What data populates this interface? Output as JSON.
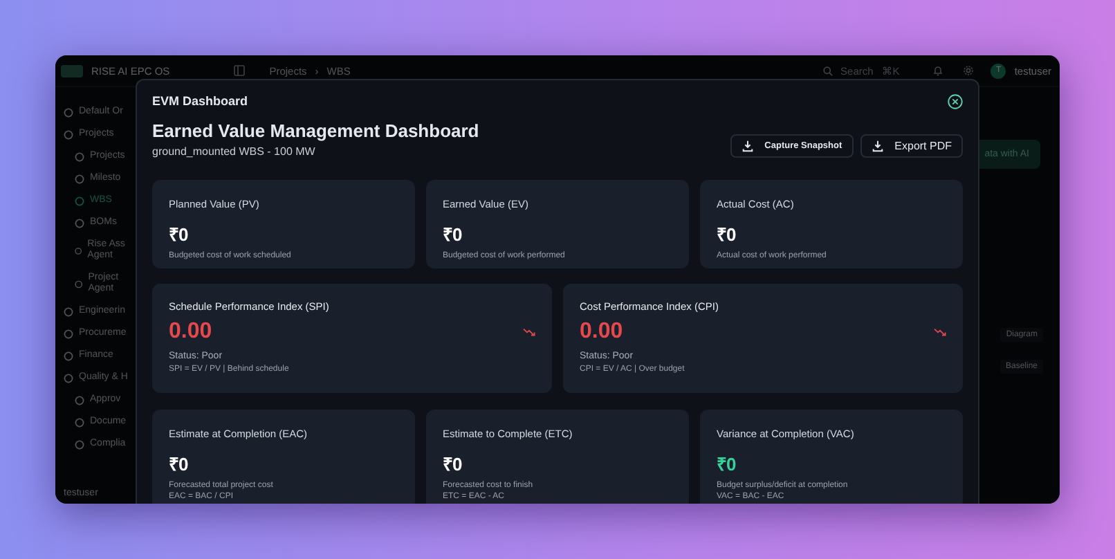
{
  "app": {
    "title": "RISE AI EPC OS",
    "breadcrumbs": [
      "Projects",
      "WBS"
    ],
    "breadcrumb_separator": "›",
    "search": {
      "placeholder": "Search",
      "shortcut": "⌘K"
    },
    "user": {
      "initial": "T",
      "name": "testuser"
    }
  },
  "sidebar": {
    "items": [
      {
        "label": "Default Or",
        "selected": false
      },
      {
        "label": "Projects",
        "selected": false,
        "children": [
          {
            "label": "Projects",
            "selected": false
          },
          {
            "label": "Milesto",
            "selected": false
          },
          {
            "label": "WBS",
            "selected": true
          },
          {
            "label": "BOMs",
            "selected": false
          },
          {
            "label": "Rise Ass Agent",
            "selected": false
          },
          {
            "label": "Project Agent",
            "selected": false
          }
        ]
      },
      {
        "label": "Engineerin",
        "selected": false
      },
      {
        "label": "Procureme",
        "selected": false
      },
      {
        "label": "Finance",
        "selected": false
      },
      {
        "label": "Quality & H",
        "selected": false,
        "children": [
          {
            "label": "Approv",
            "selected": false
          },
          {
            "label": "Docume",
            "selected": false
          },
          {
            "label": "Complia",
            "selected": false
          }
        ]
      }
    ],
    "footer_user": "testuser"
  },
  "background": {
    "button": "ata with AI",
    "labels": [
      "Diagram",
      "Baseline"
    ]
  },
  "modal": {
    "title": "EVM Dashboard",
    "heading": "Earned Value Management Dashboard",
    "subtitle": "ground_mounted WBS - 100 MW",
    "actions": [
      {
        "label": "Capture Snapshot"
      },
      {
        "label": "Export PDF"
      }
    ],
    "metrics": [
      {
        "label": "Planned Value (PV)",
        "value": "₹0",
        "color": "#ffffff",
        "notes": [
          "Budgeted cost of work scheduled"
        ]
      },
      {
        "label": "Earned Value (EV)",
        "value": "₹0",
        "color": "#ffffff",
        "notes": [
          "Budgeted cost of work performed"
        ]
      },
      {
        "label": "Actual Cost (AC)",
        "value": "₹0",
        "color": "#ffffff",
        "notes": [
          "Actual cost of work performed"
        ]
      }
    ],
    "indices": [
      {
        "label": "Schedule Performance Index (SPI)",
        "value": "0.00",
        "color": "#e5484d",
        "status": "Status: Poor",
        "formula": "SPI = EV / PV | Behind schedule"
      },
      {
        "label": "Cost Performance Index (CPI)",
        "value": "0.00",
        "color": "#e5484d",
        "status": "Status: Poor",
        "formula": "CPI = EV / AC | Over budget"
      }
    ],
    "forecasts": [
      {
        "label": "Estimate at Completion (EAC)",
        "value": "₹0",
        "color": "#ffffff",
        "notes": [
          "Forecasted total project cost",
          "EAC = BAC / CPI"
        ]
      },
      {
        "label": "Estimate to Complete (ETC)",
        "value": "₹0",
        "color": "#ffffff",
        "notes": [
          "Forecasted cost to finish",
          "ETC = EAC - AC"
        ]
      },
      {
        "label": "Variance at Completion (VAC)",
        "value": "₹0",
        "color": "#34d399",
        "notes": [
          "Budget surplus/deficit at completion",
          "VAC = BAC - EAC"
        ]
      }
    ]
  }
}
